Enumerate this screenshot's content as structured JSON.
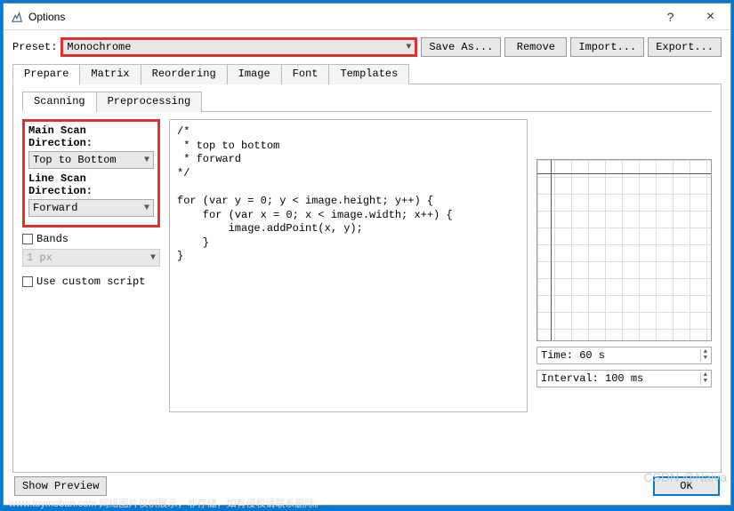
{
  "window": {
    "title": "Options"
  },
  "preset": {
    "label": "Preset:",
    "value": "Monochrome",
    "buttons": {
      "save": "Save As...",
      "remove": "Remove",
      "import": "Import...",
      "export": "Export..."
    }
  },
  "tabs": [
    "Prepare",
    "Matrix",
    "Reordering",
    "Image",
    "Font",
    "Templates"
  ],
  "subtabs": [
    "Scanning",
    "Preprocessing"
  ],
  "scan": {
    "main_label": "Main Scan Direction:",
    "main_value": "Top to Bottom",
    "line_label": "Line Scan Direction:",
    "line_value": "Forward",
    "bands_label": "Bands",
    "bands_value": "1 px",
    "custom_label": "Use custom script"
  },
  "code": "/*\n * top to bottom\n * forward\n*/\n\nfor (var y = 0; y < image.height; y++) {\n    for (var x = 0; x < image.width; x++) {\n        image.addPoint(x, y);\n    }\n}",
  "right": {
    "time_label": "Time: 60 s",
    "interval_label": "Interval: 100 ms"
  },
  "bottom": {
    "show_preview": "Show Preview",
    "ok": "OK"
  },
  "watermark": "CSDN @Naiva",
  "watermark2": "www.toymoban.com 网络图片仅供展示，非存储，如有侵权请联系删除。"
}
